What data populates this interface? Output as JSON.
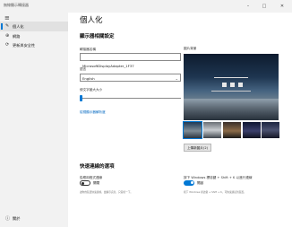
{
  "window": {
    "title": "無線顯示轉接器"
  },
  "sidebar": {
    "items": [
      {
        "label": "個人化",
        "icon": "brush-icon",
        "active": true
      },
      {
        "label": "網路",
        "icon": "globe-icon",
        "active": false
      },
      {
        "label": "更新與安全性",
        "icon": "sync-icon",
        "active": false
      }
    ],
    "about_label": "關於"
  },
  "main": {
    "page_title": "個人化",
    "display_settings": {
      "title": "顯示器相關設定",
      "name_label": "轉接器名稱",
      "name_value": "MicrosoftDisplayAdapter_1F37",
      "language_label": "語言",
      "language_value": "English",
      "text_size_label": "使文字變大大小",
      "text_size_value": 0,
      "link": "檢視顯示器解析度"
    },
    "preview": {
      "label": "圖片背景",
      "caption": "",
      "upload_label": "上傳新圖片(2)"
    },
    "quick_settings": {
      "title": "快速連線的選項",
      "left_label": "從應用程式連線",
      "left_toggle": "關閉",
      "left_toggle_on": false,
      "left_desc": "讓你的裝置快速連線，並顯示訊息，只需按一下。",
      "right_label": "按下 Windows 標誌鍵 + Shift + K 以進行連線",
      "right_toggle": "開啟",
      "right_toggle_on": true,
      "right_desc": "按下 Windows 標誌鍵 + Shift + K，可快速連接到裝置。"
    }
  },
  "colors": {
    "accent": "#0078d4",
    "link": "#0067c0"
  }
}
